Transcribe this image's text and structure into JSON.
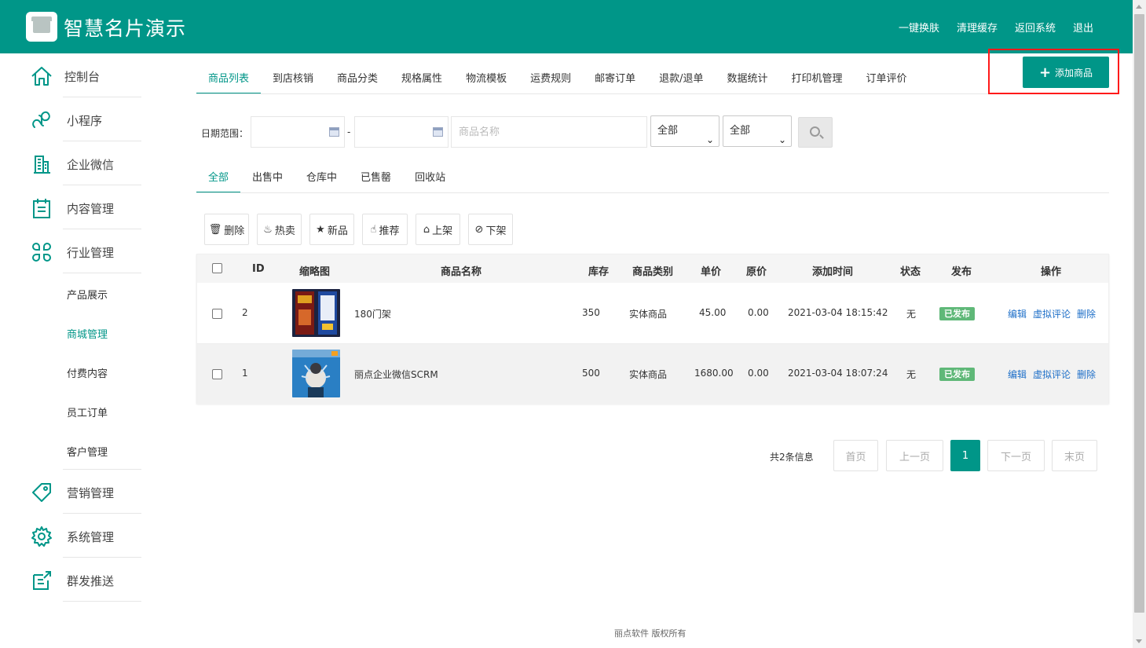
{
  "header": {
    "title": "智慧名片演示",
    "links": [
      "一键换肤",
      "清理缓存",
      "返回系统",
      "退出"
    ]
  },
  "sidebar": {
    "items": [
      {
        "label": "控制台",
        "icon": "home-icon"
      },
      {
        "label": "小程序",
        "icon": "miniprogram-icon"
      },
      {
        "label": "企业微信",
        "icon": "building-icon"
      },
      {
        "label": "内容管理",
        "icon": "clipboard-icon"
      },
      {
        "label": "行业管理",
        "icon": "clover-icon"
      },
      {
        "label": "营销管理",
        "icon": "tag-icon"
      },
      {
        "label": "系统管理",
        "icon": "gear-icon"
      },
      {
        "label": "群发推送",
        "icon": "share-icon"
      }
    ],
    "subitems": [
      "产品展示",
      "商城管理",
      "付费内容",
      "员工订单",
      "客户管理"
    ],
    "active_subitem": "商城管理"
  },
  "tabs": [
    "商品列表",
    "到店核销",
    "商品分类",
    "规格属性",
    "物流模板",
    "运费规则",
    "邮寄订单",
    "退款/退单",
    "数据统计",
    "打印机管理",
    "订单评价"
  ],
  "add_button": "添加商品",
  "filter": {
    "date_label": "日期范围：",
    "dash": "-",
    "name_placeholder": "商品名称",
    "select1": "全部",
    "select2": "全部"
  },
  "status_tabs": [
    "全部",
    "出售中",
    "仓库中",
    "已售罄",
    "回收站"
  ],
  "actions": [
    {
      "label": "删除",
      "icon": "trash-icon"
    },
    {
      "label": "热卖",
      "icon": "fire-icon"
    },
    {
      "label": "新品",
      "icon": "star-icon"
    },
    {
      "label": "推荐",
      "icon": "thumbs-up-icon"
    },
    {
      "label": "上架",
      "icon": "home-icon"
    },
    {
      "label": "下架",
      "icon": "eye-slash-icon"
    }
  ],
  "table": {
    "headers": [
      "ID",
      "缩略图",
      "商品名称",
      "库存",
      "商品类别",
      "单价",
      "原价",
      "添加时间",
      "状态",
      "发布",
      "操作"
    ],
    "rows": [
      {
        "id": "2",
        "name": "180门架",
        "stock": "350",
        "category": "实体商品",
        "price": "45.00",
        "orig": "0.00",
        "time": "2021-03-04 18:15:42",
        "status": "无",
        "publish": "已发布",
        "ops": [
          "编辑",
          "虚拟评论",
          "删除"
        ]
      },
      {
        "id": "1",
        "name": "丽点企业微信SCRM",
        "stock": "500",
        "category": "实体商品",
        "price": "1680.00",
        "orig": "0.00",
        "time": "2021-03-04 18:07:24",
        "status": "无",
        "publish": "已发布",
        "ops": [
          "编辑",
          "虚拟评论",
          "删除"
        ]
      }
    ]
  },
  "pagination": {
    "count": "共2条信息",
    "first": "首页",
    "prev": "上一页",
    "current": "1",
    "next": "下一页",
    "last": "末页"
  },
  "footer": "丽点软件 版权所有",
  "colors": {
    "accent": "#009688",
    "badge": "#5fb878",
    "link": "#1e6fc8",
    "highlight": "#ff1a1a"
  }
}
